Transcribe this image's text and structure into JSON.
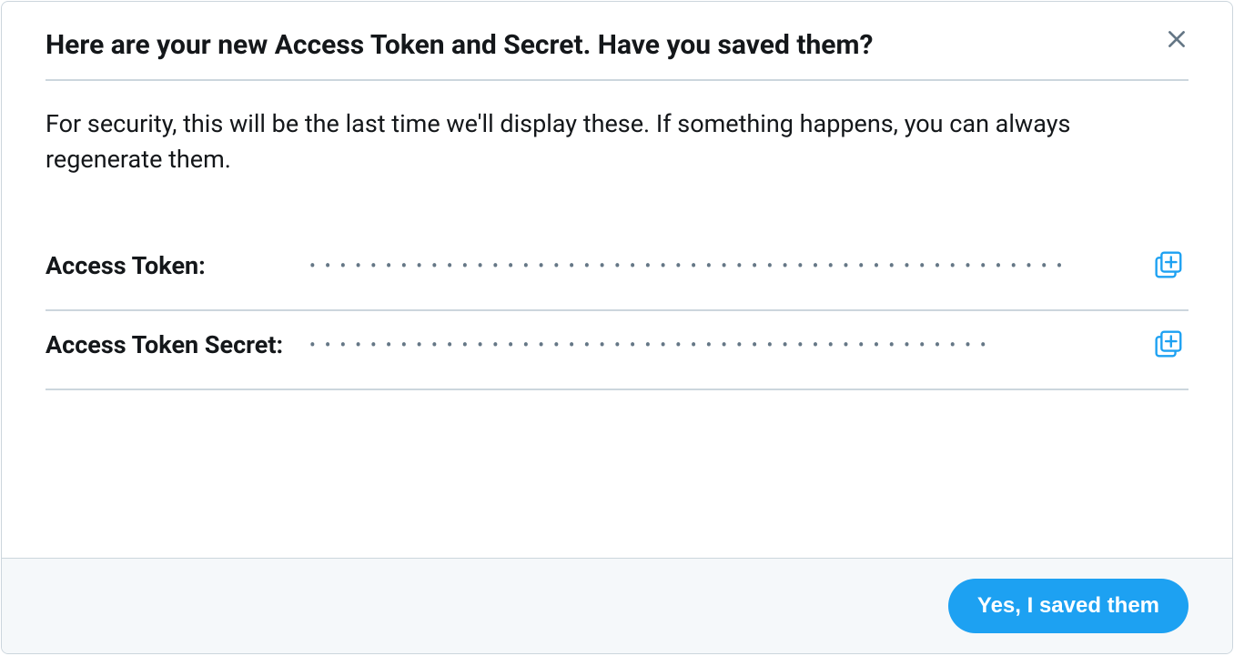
{
  "dialog": {
    "title": "Here are your new Access Token and Secret. Have you saved them?",
    "description": "For security, this will be the last time we'll display these. If something happens, you can always regenerate them.",
    "rows": [
      {
        "label": "Access Token:",
        "masked_value": "••••••••••••••••••••••••••••••••••••••••••••••••••"
      },
      {
        "label": "Access Token Secret:",
        "masked_value": "•••••••••••••••••••••••••••••••••••••••••••••"
      }
    ],
    "confirm_label": "Yes, I saved them"
  },
  "colors": {
    "accent": "#1da1f2",
    "text": "#14171a",
    "muted": "#657786",
    "border": "#ccd6dd",
    "footer_bg": "#f5f8fa"
  }
}
